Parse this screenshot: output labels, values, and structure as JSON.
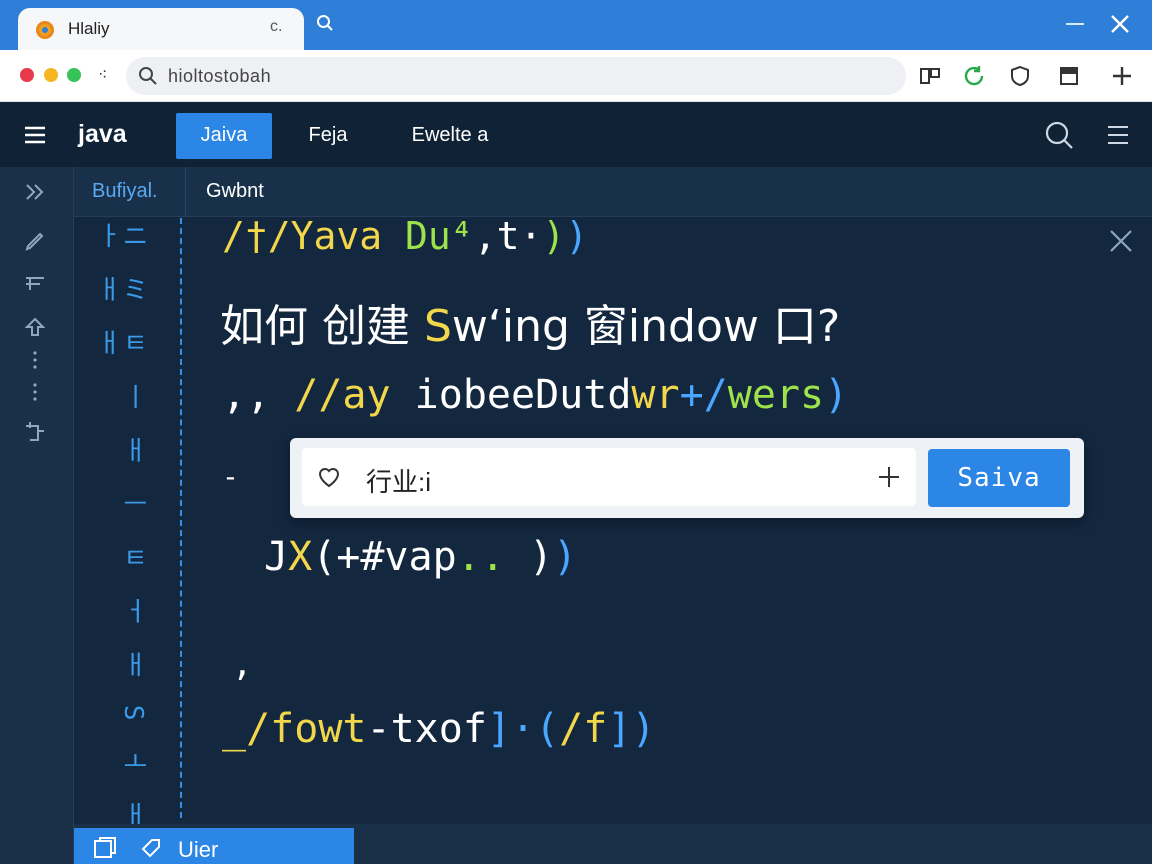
{
  "browser": {
    "tab_title": "Hlaliy",
    "tab_audio_glyph": "c.",
    "address_text": "hioltostobah"
  },
  "header": {
    "app_title": "java",
    "nav": [
      {
        "label": "Jaiva",
        "active": true
      },
      {
        "label": "Feja",
        "active": false
      },
      {
        "label": "Ewelte a",
        "active": false
      }
    ]
  },
  "editor": {
    "tabs": [
      {
        "label": "Bufiyal.",
        "active": true
      },
      {
        "label": "Gwbnt",
        "active": false
      }
    ],
    "gutter_text": "ニ ミ ㅌ ㅣ ㅐ ㅡ ㅌ ㅓ ㅐ S ㅗ ㅐ ㅏ ㅐ ㅐ",
    "line1": {
      "a": "/†/",
      "b": "Yava",
      "c": "Du⁴",
      "d": ",t·",
      "e": ")",
      "f": ")"
    },
    "line2": {
      "a": "如何 创建 ",
      "b": "S",
      "c": "w‘ing 窗indow 口?"
    },
    "line3": {
      "a": ",, ",
      "b": "//ay ",
      "c": "iobeeDutd",
      "d": "wr",
      "e": "+/",
      "f": "wers",
      "g": ")"
    },
    "line4": "-",
    "line5": {
      "a": "J",
      "b": "X",
      "c": "(+#vap",
      "d": "..",
      "e": ")",
      "f": ")"
    },
    "line6": ",",
    "line7": {
      "a": "_/",
      "b": "fowt",
      "c": "-txof",
      "d": "]·(",
      "e": "/f",
      "f": "]",
      "g": ")"
    }
  },
  "popup": {
    "input_value": "行业:i",
    "save_label": "Saiva"
  },
  "footer": {
    "tab_label": "Uier"
  },
  "icons": {
    "hamburger": "hamburger-icon",
    "search": "search-icon",
    "list": "list-icon",
    "close": "close-icon",
    "heart": "heart-icon",
    "plus": "plus-icon"
  },
  "colors": {
    "accent": "#2b86e6",
    "editor_bg": "#13273f",
    "keyword_yellow": "#f2d64b",
    "keyword_green": "#9ee34a",
    "bracket_blue": "#4aa6ff"
  }
}
